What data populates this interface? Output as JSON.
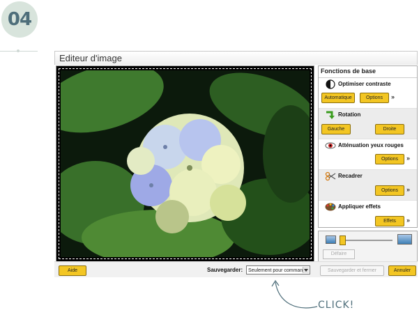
{
  "step": {
    "number": "04"
  },
  "window": {
    "title": "Editeur d'image"
  },
  "panel": {
    "title": "Fonctions de base",
    "sections": [
      {
        "title": "Optimiser contraste",
        "icon": "contrast-icon",
        "buttons": [
          "Automatique",
          "Options"
        ]
      },
      {
        "title": "Rotation",
        "icon": "rotate-arrow-icon",
        "buttons": [
          "Gauche",
          "Droite"
        ]
      },
      {
        "title": "Atténuation yeux rouges",
        "icon": "red-eye-icon",
        "buttons": [
          "Options"
        ]
      },
      {
        "title": "Recadrer",
        "icon": "scissors-icon",
        "buttons": [
          "Options"
        ]
      },
      {
        "title": "Appliquer effets",
        "icon": "palette-icon",
        "buttons": [
          "Effets"
        ]
      }
    ],
    "chevron": "»"
  },
  "adjust": {
    "undo_label": "Défaire"
  },
  "footer": {
    "help_label": "Aide",
    "save_label": "Sauvegarder:",
    "save_option": "Seulement pour commande",
    "save_close_label": "Sauvegarder et fermer",
    "cancel_label": "Annuler"
  },
  "annotation": {
    "click_text": "CLICK!"
  },
  "colors": {
    "accent_button": "#f3c623",
    "badge_bg": "#d8e4dc",
    "badge_text": "#4e6e7a"
  }
}
